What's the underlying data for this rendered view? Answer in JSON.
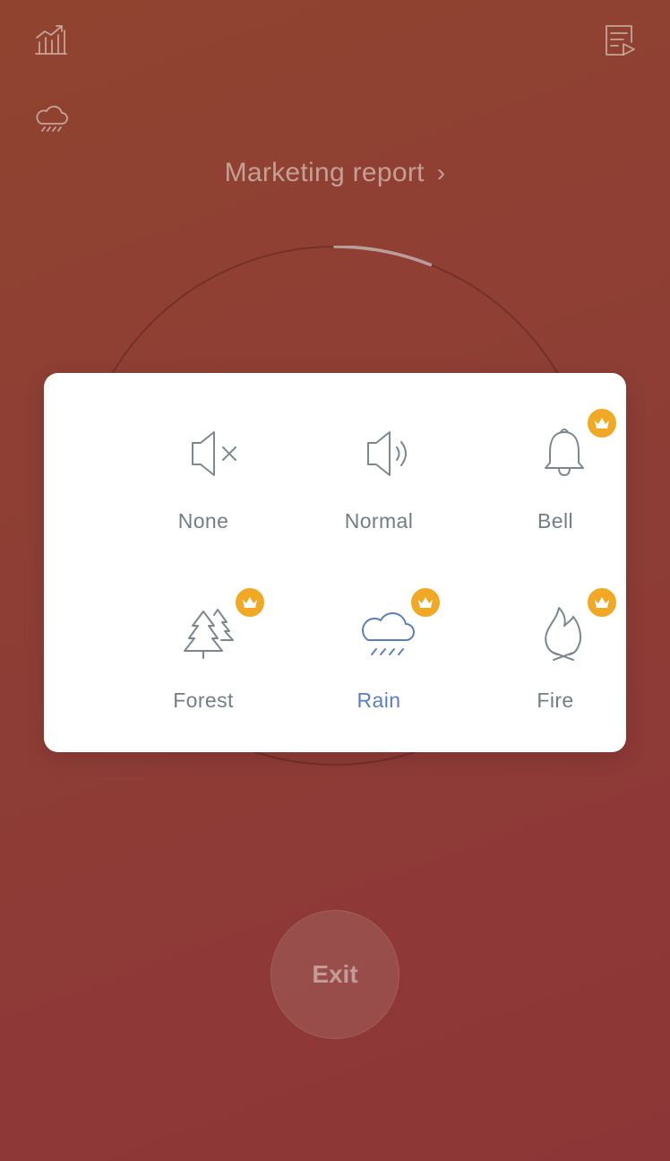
{
  "header": {
    "task_title": "Marketing report",
    "chevron": "›"
  },
  "icons": {
    "stats": "stats-chart-icon",
    "weather": "rain-cloud-icon",
    "playlist": "playlist-play-icon"
  },
  "timer": {
    "progress": 0.06
  },
  "sound_panel": {
    "options": [
      {
        "label": "None",
        "icon": "mute-speaker-icon",
        "premium": false,
        "selected": false
      },
      {
        "label": "Normal",
        "icon": "speaker-icon",
        "premium": false,
        "selected": false
      },
      {
        "label": "Bell",
        "icon": "bell-icon",
        "premium": true,
        "selected": false
      },
      {
        "label": "Forest",
        "icon": "forest-icon",
        "premium": true,
        "selected": false
      },
      {
        "label": "Rain",
        "icon": "rain-cloud-icon",
        "premium": true,
        "selected": true
      },
      {
        "label": "Fire",
        "icon": "fire-icon",
        "premium": true,
        "selected": false
      }
    ]
  },
  "footer": {
    "exit_label": "Exit"
  },
  "colors": {
    "background": "#9a4a34",
    "selected": "#5a7fc0",
    "icon": "#7d8790",
    "premium_badge": "#f1a825"
  }
}
